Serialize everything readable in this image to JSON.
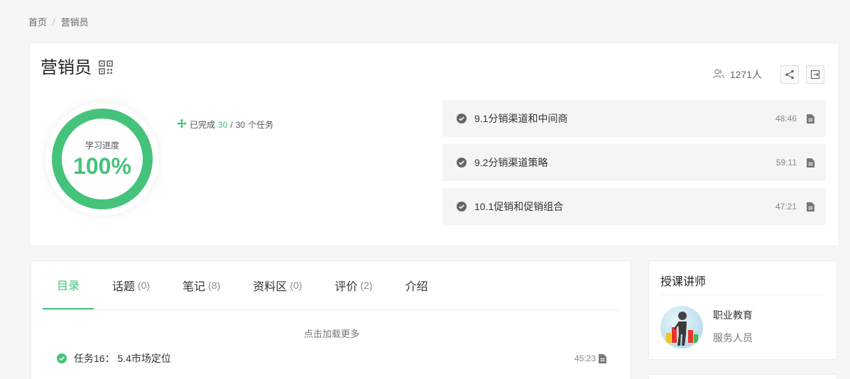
{
  "breadcrumb": {
    "home": "首页",
    "separator": "/",
    "current": "营销员"
  },
  "course": {
    "title": "营销员"
  },
  "stats": {
    "people": "1271人"
  },
  "progress": {
    "label": "学习进度",
    "value": "100%",
    "fraction": 1.0,
    "done_prefix": "已完成",
    "done": "30",
    "slash": "/",
    "total": "30",
    "done_suffix": "个任务"
  },
  "recent_tasks": [
    {
      "name": "9.1分销渠道和中间商",
      "time": "48:46"
    },
    {
      "name": "9.2分销渠道策略",
      "time": "59:11"
    },
    {
      "name": "10.1促销和促销组合",
      "time": "47:21"
    }
  ],
  "tabs": [
    {
      "label": "目录",
      "count": ""
    },
    {
      "label": "话题",
      "count": "(0)"
    },
    {
      "label": "笔记",
      "count": "(8)"
    },
    {
      "label": "资料区",
      "count": "(0)"
    },
    {
      "label": "评价",
      "count": "(2)"
    },
    {
      "label": "介绍",
      "count": ""
    }
  ],
  "catalog": {
    "load_more": "点击加载更多",
    "lessons": [
      {
        "name": "任务16： 5.4市场定位",
        "time": "45:23"
      }
    ]
  },
  "teacher": {
    "heading": "授课讲师",
    "name": "职业教育",
    "role": "服务人员"
  },
  "colors": {
    "accent": "#46c37b",
    "check_gray": "#666666"
  }
}
